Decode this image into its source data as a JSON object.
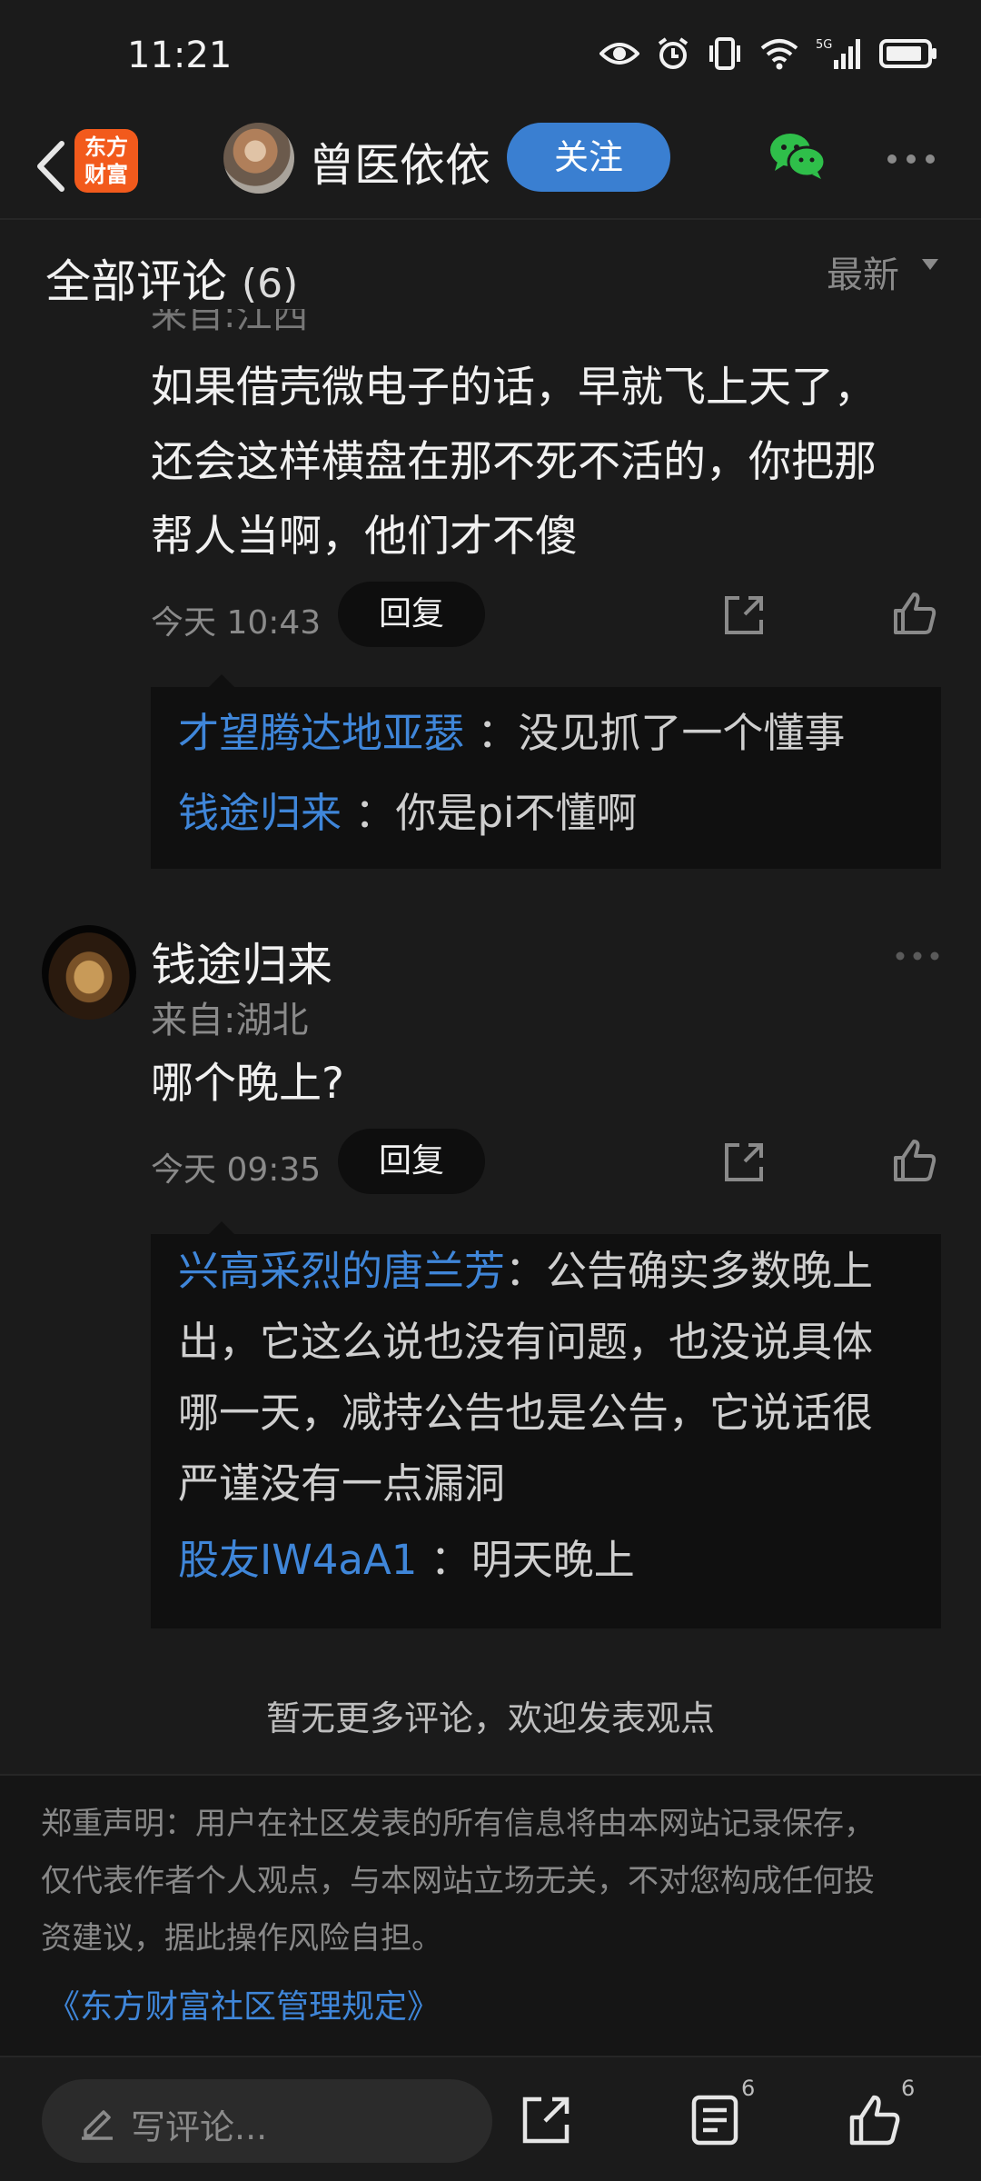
{
  "status_bar": {
    "time": "11:21"
  },
  "header": {
    "app_logo_text_1": "东方",
    "app_logo_text_2": "财富",
    "author_name": "曾医依依",
    "follow_label": "关注"
  },
  "section": {
    "title": "全部评论",
    "count": "(6)",
    "sort_label": "最新"
  },
  "comments": [
    {
      "clipped_location": "来自:江西",
      "text_lines": [
        "如果借壳微电子的话，早就飞上天了，",
        "还会这样横盘在那不死不活的，你把那",
        "帮人当啊，他们才不傻"
      ],
      "time": "今天 10:43",
      "reply_label": "回复",
      "replies": [
        {
          "name": "才望腾达地亚瑟",
          "text": "：没见抓了一个懂事"
        },
        {
          "name": "钱途归来",
          "text": "：你是pi不懂啊"
        }
      ]
    },
    {
      "username": "钱途归来",
      "location": "来自:湖北",
      "text_lines": [
        "哪个晚上?"
      ],
      "time": "今天 09:35",
      "reply_label": "回复",
      "replies": [
        {
          "name": "兴高采烈的唐兰芳",
          "text_lines": [
            "：公告确实多数晚上",
            "出，它这么说也没有问题，也没说具体",
            "哪一天，减持公告也是公告，它说话很",
            "严谨没有一点漏洞"
          ]
        },
        {
          "name": "股友IW4aA1",
          "text": "：明天晚上"
        }
      ]
    }
  ],
  "no_more_text": "暂无更多评论，欢迎发表观点",
  "disclaimer": {
    "lines": [
      "郑重声明：用户在社区发表的所有信息将由本网站记录保存，",
      "仅代表作者个人观点，与本网站立场无关，不对您构成任何投",
      "资建议，据此操作风险自担。"
    ],
    "link": "《东方财富社区管理规定》"
  },
  "bottom_bar": {
    "comment_placeholder": "写评论...",
    "comments_count": "6",
    "likes_count": "6"
  },
  "colors": {
    "background": "#1b1b1b",
    "accent_blue": "#3a7fd1",
    "name_blue": "#3f86d9",
    "brand_orange": "#f25a1c"
  }
}
